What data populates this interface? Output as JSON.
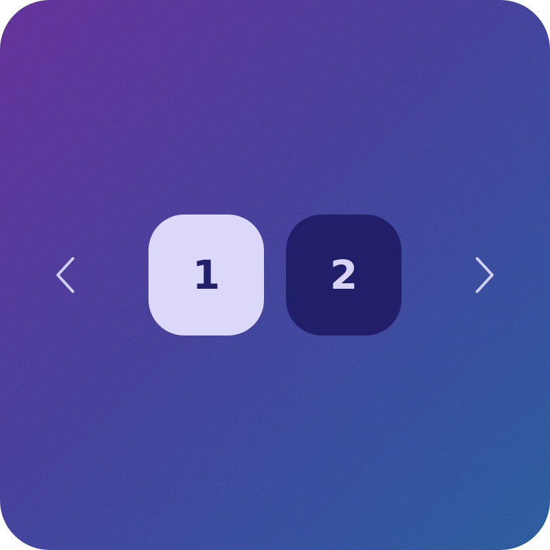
{
  "pagination": {
    "prev_icon": "chevron-left-icon",
    "next_icon": "chevron-right-icon",
    "pages": [
      {
        "label": "1",
        "state": "active"
      },
      {
        "label": "2",
        "state": "inactive"
      }
    ]
  },
  "colors": {
    "background_start": "#5a2d8c",
    "background_end": "#285490",
    "active_page_bg": "#dcd8fa",
    "active_page_text": "#23206a",
    "inactive_page_bg": "#221f6a",
    "inactive_page_text": "#d8d5f6",
    "arrow_color": "#cfd0f5"
  }
}
